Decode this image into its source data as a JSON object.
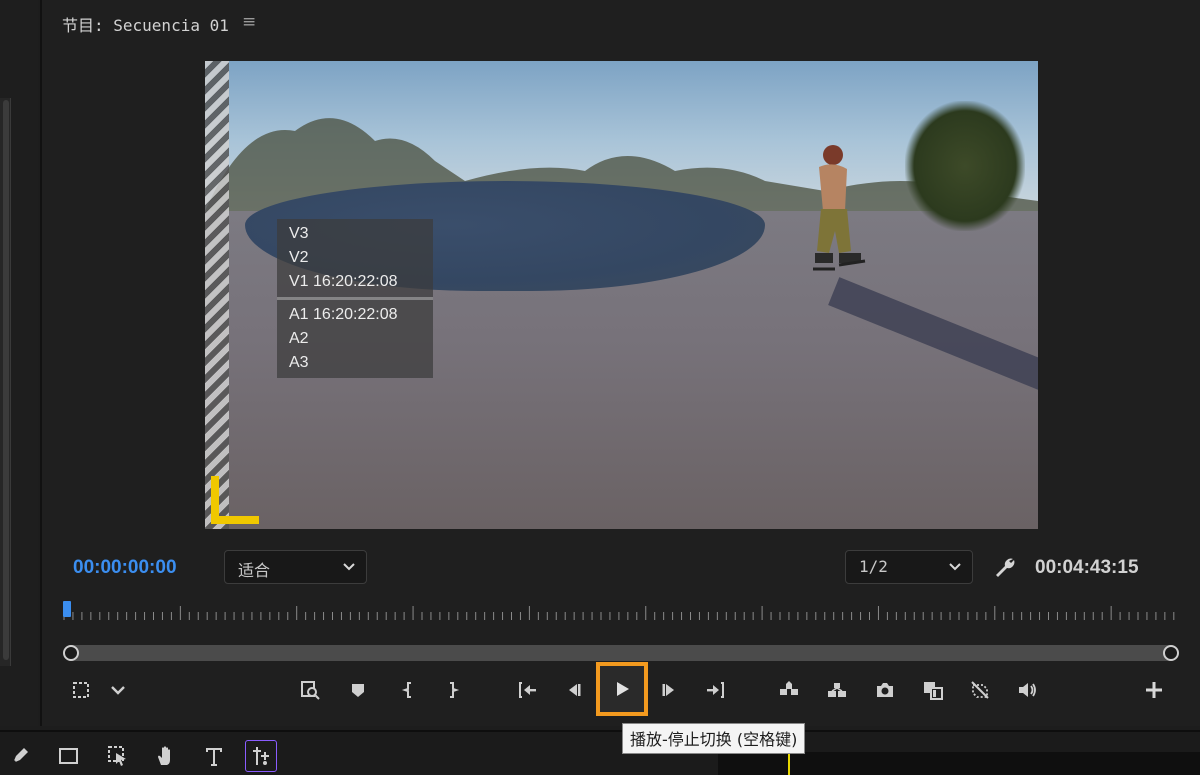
{
  "program_monitor": {
    "title": "节目: Secuencia 01",
    "menu_icon": "hamburger-icon"
  },
  "overlay": {
    "video_tracks": [
      "V3",
      "V2",
      "V1 16:20:22:08"
    ],
    "audio_tracks": [
      "A1 16:20:22:08",
      "A2",
      "A3"
    ]
  },
  "controls": {
    "current_timecode": "00:00:00:00",
    "zoom_value": "适合",
    "resolution_value": "1/2",
    "duration_timecode": "00:04:43:15"
  },
  "transport_buttons": [
    {
      "name": "add-marker-icon"
    },
    {
      "name": "mark-in-icon"
    },
    {
      "name": "mark-out-icon"
    },
    {
      "name": "go-to-in-icon"
    },
    {
      "name": "step-back-icon"
    },
    {
      "name": "play-icon"
    },
    {
      "name": "step-forward-icon"
    },
    {
      "name": "go-to-out-icon"
    },
    {
      "name": "lift-icon"
    },
    {
      "name": "extract-icon"
    },
    {
      "name": "export-frame-icon"
    },
    {
      "name": "comparison-view-icon"
    },
    {
      "name": "toggle-proxies-icon"
    },
    {
      "name": "audio-icon"
    }
  ],
  "tooltip": {
    "text": "播放-停止切换 (空格键)"
  },
  "tools": [
    "pen-icon",
    "rectangle-icon",
    "selection-icon",
    "hand-icon",
    "type-icon",
    "remix-icon"
  ],
  "colors": {
    "timecode_blue": "#3b8ef0",
    "highlight_orange": "#f39a1f",
    "safe_margin_yellow": "#f0c800",
    "active_tool_purple": "#8a5cff"
  }
}
